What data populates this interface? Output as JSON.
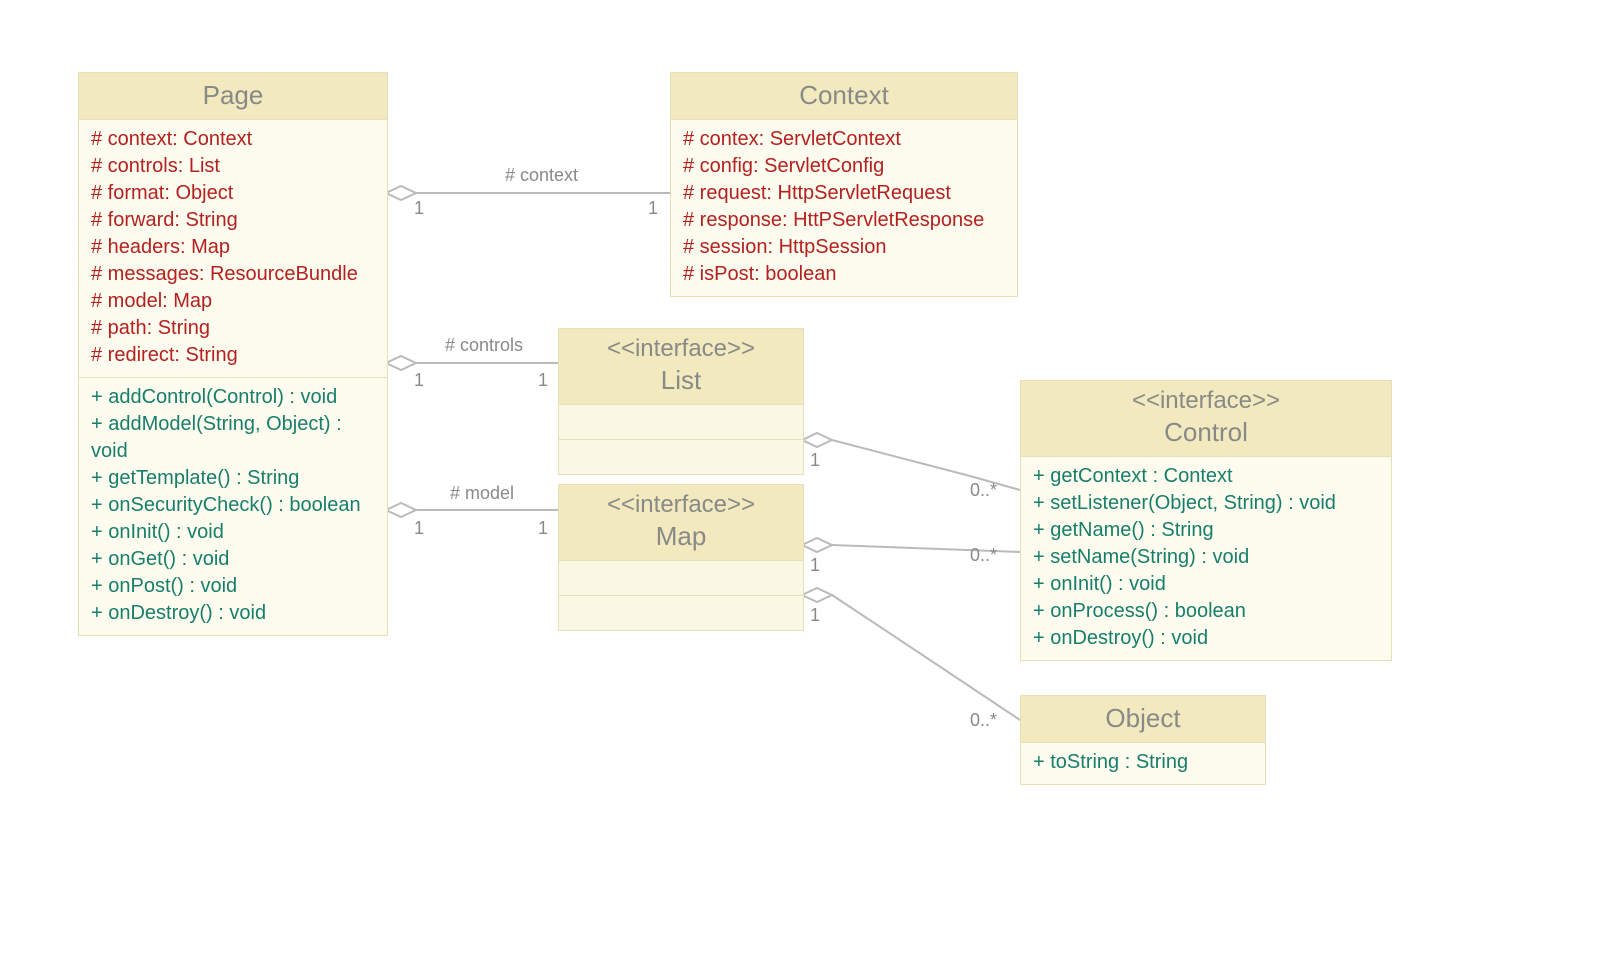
{
  "classes": {
    "page": {
      "name": "Page",
      "attrs": [
        "# context: Context",
        "# controls: List",
        "# format: Object",
        "# forward: String",
        "# headers: Map",
        "# messages: ResourceBundle",
        "# model: Map",
        "# path: String",
        "# redirect: String"
      ],
      "meths": [
        "+ addControl(Control) : void",
        "+ addModel(String, Object) : void",
        "+ getTemplate() : String",
        "+ onSecurityCheck() : boolean",
        "+ onInit() : void",
        "+ onGet() : void",
        "+ onPost() : void",
        "+ onDestroy() : void"
      ]
    },
    "context": {
      "name": "Context",
      "attrs": [
        "# contex: ServletContext",
        "# config: ServletConfig",
        "# request: HttpServletRequest",
        "# response: HttPServletResponse",
        "# session: HttpSession",
        "# isPost: boolean"
      ]
    },
    "list": {
      "stereotype": "<<interface>>",
      "name": "List"
    },
    "map": {
      "stereotype": "<<interface>>",
      "name": "Map"
    },
    "control": {
      "stereotype": "<<interface>>",
      "name": "Control",
      "meths": [
        "+ getContext : Context",
        "+ setListener(Object, String) : void",
        "+ getName() : String",
        "+ setName(String) : void",
        "+ onInit() : void",
        "+ onProcess() : boolean",
        "+ onDestroy() : void"
      ]
    },
    "object": {
      "name": "Object",
      "meths": [
        "+ toString : String"
      ]
    }
  },
  "labels": {
    "context": "# context",
    "controls": "# controls",
    "model": "# model"
  },
  "mult": {
    "one": "1",
    "many": "0..*"
  }
}
